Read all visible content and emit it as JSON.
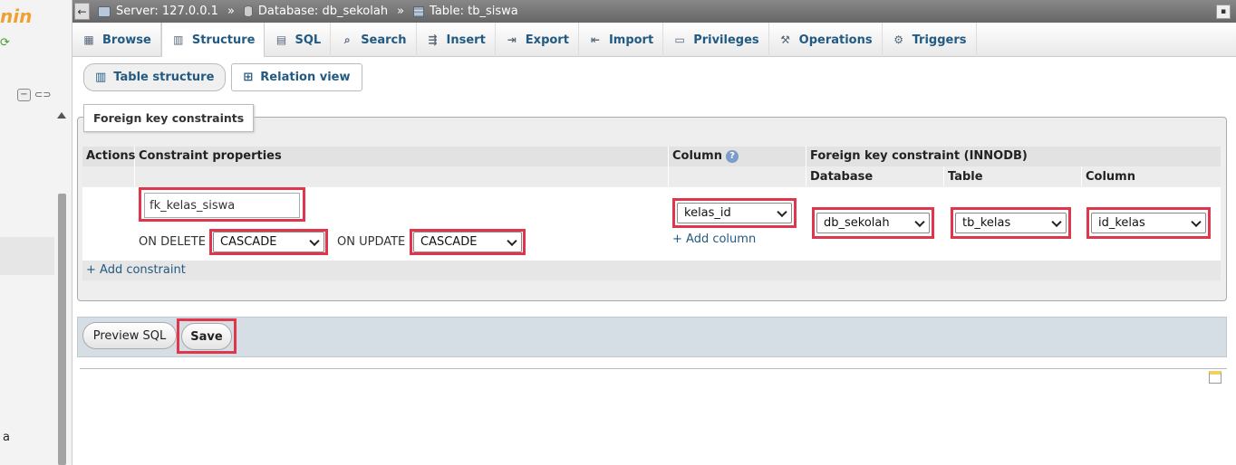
{
  "nav": {
    "logo_text": "nin",
    "reload_icon": "reload-icon",
    "collapse_label": "−",
    "bottom_letter": "a"
  },
  "breadcrumb": {
    "back_label": "←",
    "server": "Server: 127.0.0.1",
    "database": "Database: db_sekolah",
    "table": "Table: tb_siswa",
    "separator": "»"
  },
  "tabs": [
    {
      "label": "Browse",
      "icon": "browse-icon"
    },
    {
      "label": "Structure",
      "icon": "structure-icon"
    },
    {
      "label": "SQL",
      "icon": "sql-icon"
    },
    {
      "label": "Search",
      "icon": "search-icon"
    },
    {
      "label": "Insert",
      "icon": "insert-icon"
    },
    {
      "label": "Export",
      "icon": "export-icon"
    },
    {
      "label": "Import",
      "icon": "import-icon"
    },
    {
      "label": "Privileges",
      "icon": "privileges-icon"
    },
    {
      "label": "Operations",
      "icon": "operations-icon"
    },
    {
      "label": "Triggers",
      "icon": "triggers-icon"
    }
  ],
  "subtabs": {
    "table_structure": "Table structure",
    "relation_view": "Relation view"
  },
  "fieldset": {
    "legend": "Foreign key constraints"
  },
  "headers": {
    "actions": "Actions",
    "constraint_properties": "Constraint properties",
    "column": "Column",
    "fk_constraint": "Foreign key constraint (INNODB)",
    "database": "Database",
    "table": "Table",
    "ref_column": "Column"
  },
  "row": {
    "constraint_name": "fk_kelas_siswa",
    "on_delete_label": "ON DELETE",
    "on_delete_value": "CASCADE",
    "on_update_label": "ON UPDATE",
    "on_update_value": "CASCADE",
    "column_value": "kelas_id",
    "add_column": "+ Add column",
    "database_value": "db_sekolah",
    "table_value": "tb_kelas",
    "ref_column_value": "id_kelas"
  },
  "add_constraint": "+ Add constraint",
  "footer": {
    "preview_sql": "Preview SQL",
    "save": "Save"
  },
  "colors": {
    "accent_link": "#235a81",
    "highlight_red": "#e0364b"
  }
}
